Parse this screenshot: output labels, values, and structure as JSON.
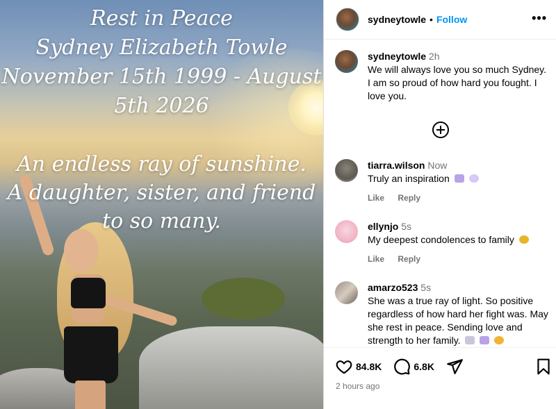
{
  "media": {
    "caption_top": [
      "Rest in Peace",
      "Sydney Elizabeth Towle",
      "November 15th 1999 - August",
      "5th 2026"
    ],
    "caption_bottom": [
      "An endless ray of sunshine.",
      "A daughter, sister, and friend",
      "to so many."
    ]
  },
  "header": {
    "username": "sydneytowle",
    "separator": "•",
    "follow_label": "Follow",
    "more_label": "•••"
  },
  "caption_comment": {
    "username": "sydneytowle",
    "time": "2h",
    "text": "We will always love you so much Sydney. I am so proud of how hard you fought. I love you."
  },
  "comments": [
    {
      "username": "tiarra.wilson",
      "time": "Now",
      "text": "Truly an inspiration",
      "emojis": [
        "#b9a3e8",
        "#d8c8f5"
      ],
      "like_label": "Like",
      "reply_label": "Reply"
    },
    {
      "username": "ellynjo",
      "time": "5s",
      "text": "My deepest condolences to family",
      "emojis": [
        "#e8b52a"
      ],
      "like_label": "Like",
      "reply_label": "Reply"
    },
    {
      "username": "amarzo523",
      "time": "5s",
      "text": "She was a true ray of light. So positive regardless of how hard her fight was. May she rest in peace. Sending love and strength to her family.",
      "emojis": [
        "#c7c7d9",
        "#b9a3e8",
        "#f2b233"
      ]
    }
  ],
  "footer": {
    "likes": "84.8K",
    "comments": "6.8K",
    "posted": "2 hours ago"
  },
  "colors": {
    "accent": "#0095f6",
    "muted": "#737373"
  }
}
